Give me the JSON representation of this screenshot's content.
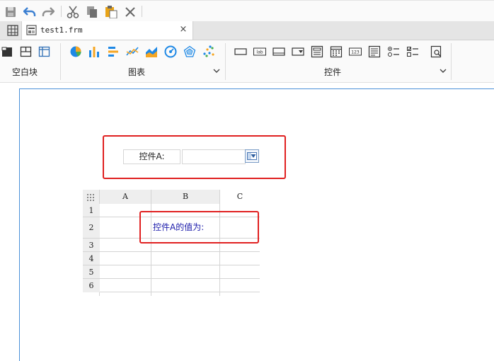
{
  "quick_toolbar": {
    "items": [
      "save-icon",
      "undo-icon",
      "redo-icon",
      "cut-icon",
      "copy-icon",
      "paste-icon",
      "delete-icon"
    ]
  },
  "tabs": {
    "file_name": "test1.frm",
    "close_glyph": "×"
  },
  "ribbon": {
    "groups": [
      {
        "label": "空白块"
      },
      {
        "label": "图表"
      },
      {
        "label": "控件"
      }
    ],
    "colors": {
      "pie": "#1e88e5",
      "bar_orange": "#f5a623",
      "bar_blue": "#1e88e5",
      "line_orange": "#f5a623",
      "area_blue": "#1e88e5"
    }
  },
  "form": {
    "widget_label": "控件A:",
    "combo_value": ""
  },
  "grid": {
    "columns": [
      "A",
      "B",
      "C"
    ],
    "rows": [
      "1",
      "2",
      "3",
      "4",
      "5",
      "6"
    ],
    "cell_b2": "控件A的值为:",
    "cell_b2_color": "#1a1aaa"
  },
  "highlight_color": "#e02020"
}
